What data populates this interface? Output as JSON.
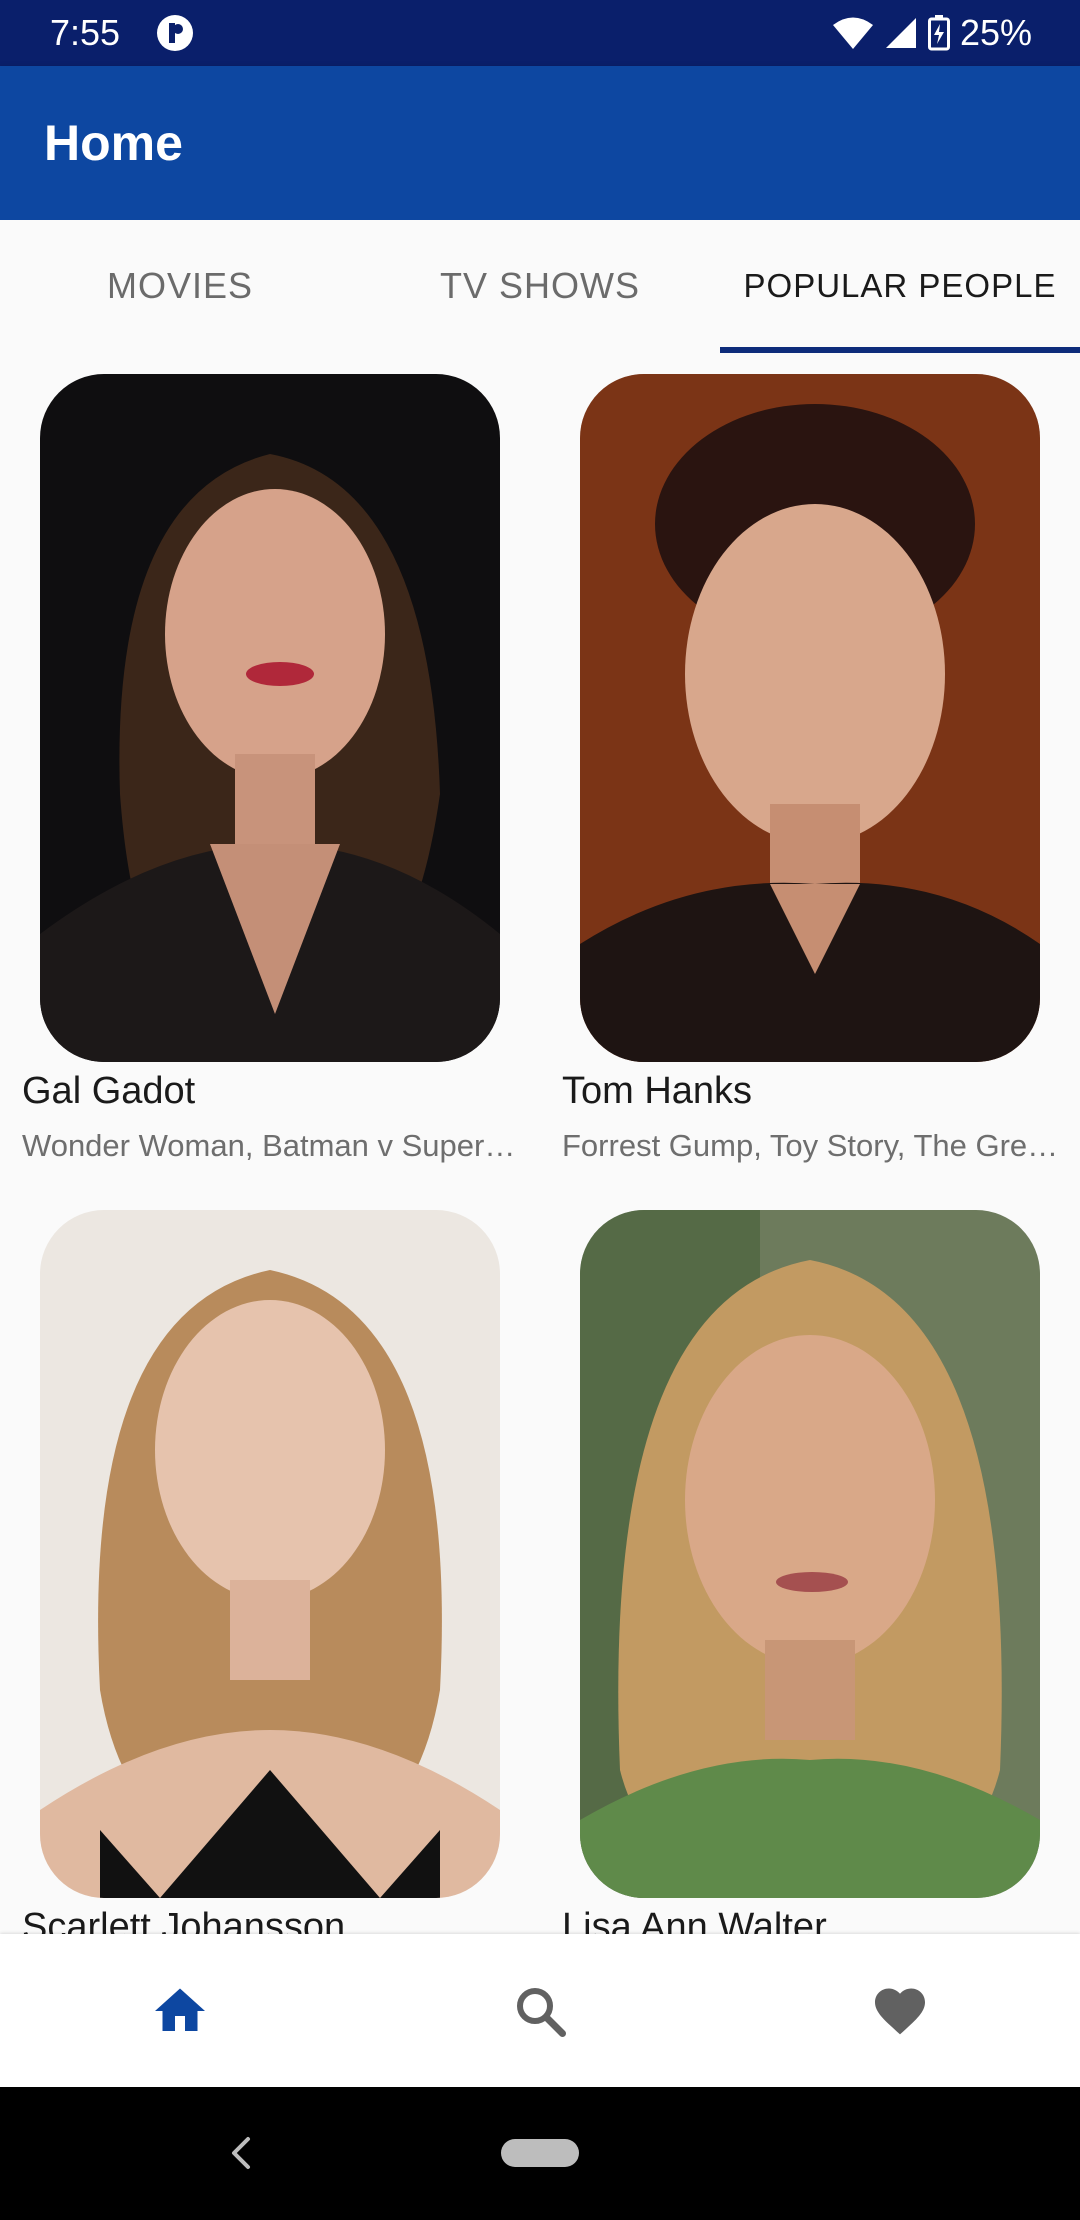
{
  "status_bar": {
    "time": "7:55",
    "battery": "25%"
  },
  "app_bar": {
    "title": "Home"
  },
  "tabs": [
    {
      "label": "MOVIES",
      "active": false
    },
    {
      "label": "TV SHOWS",
      "active": false
    },
    {
      "label": "POPULAR PEOPLE",
      "active": true
    }
  ],
  "people": [
    {
      "name": "Gal Gadot",
      "known_for": "Wonder Woman, Batman v Superman: Dawn of Justice",
      "photo_icon": "portrait-dark-hair"
    },
    {
      "name": "Tom Hanks",
      "known_for": "Forrest Gump, Toy Story, The Green Mile",
      "photo_icon": "portrait-short-hair"
    },
    {
      "name": "Scarlett Johansson",
      "known_for": "",
      "photo_icon": "portrait-blonde-hair"
    },
    {
      "name": "Lisa Ann Walter",
      "known_for": "",
      "photo_icon": "portrait-blonde-hair"
    }
  ],
  "bottom_nav": [
    {
      "icon": "home-icon",
      "active": true
    },
    {
      "icon": "search-icon",
      "active": false
    },
    {
      "icon": "heart-icon",
      "active": false
    }
  ],
  "colors": {
    "status_bar": "#0a1f6b",
    "app_bar": "#0d47a1",
    "tab_indicator": "#0d2b7a",
    "nav_active": "#0d47a1",
    "nav_inactive": "#616161"
  }
}
